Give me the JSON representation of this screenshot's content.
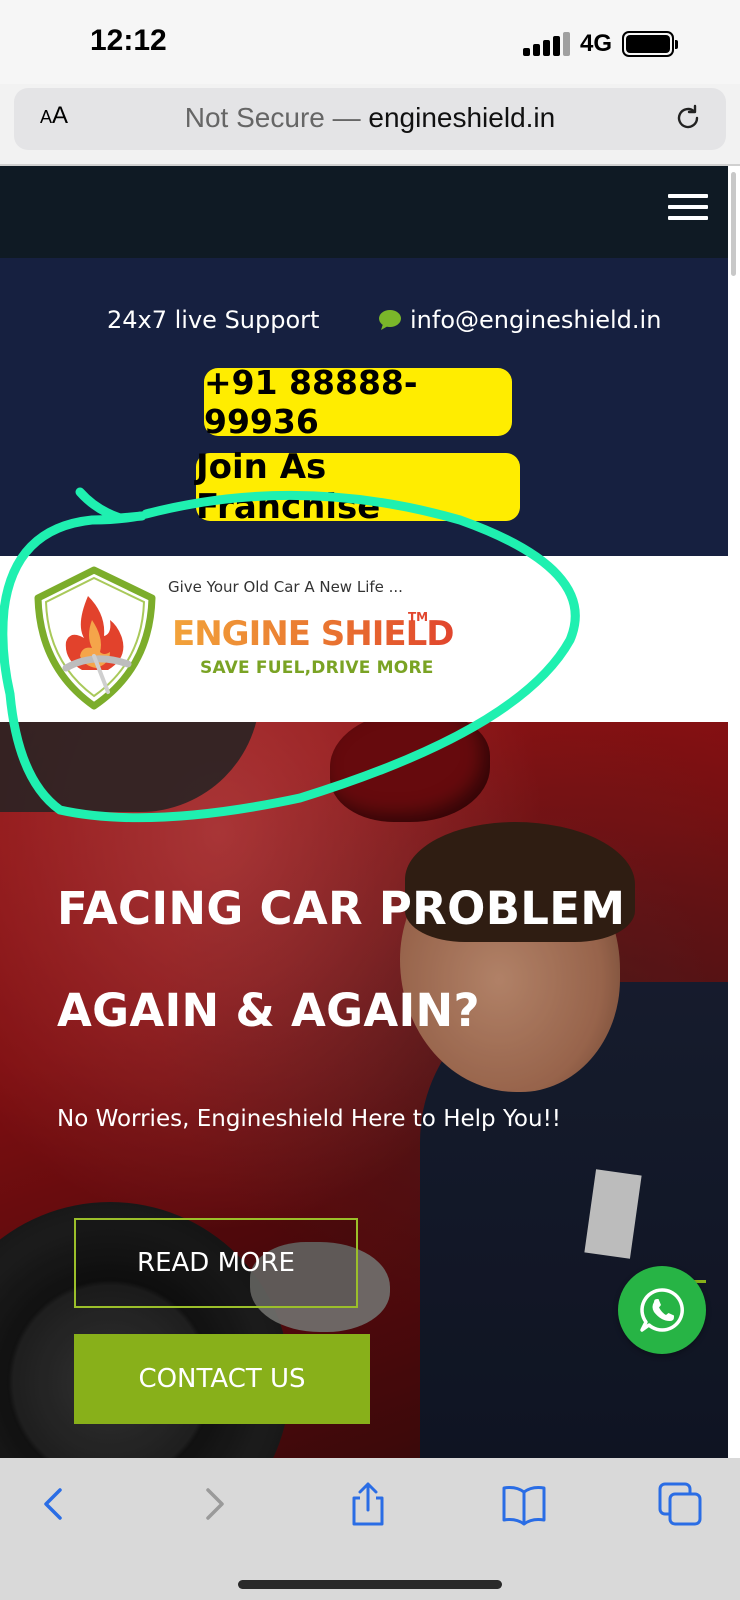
{
  "status_bar": {
    "time": "12:12",
    "network": "4G"
  },
  "browser": {
    "url_prefix": "Not Secure — ",
    "url_domain": "engineshield.in",
    "aa_small": "A",
    "aa_large": "A"
  },
  "top_info": {
    "support": "24x7 live Support",
    "email": "info@engineshield.in",
    "phone": "+91 88888-99936",
    "franchise": "Join As Franchise"
  },
  "logo": {
    "tagline": "Give Your Old Car A New Life ...",
    "brand": "ENGINE SHIELD",
    "trademark": "TM",
    "slogan": "SAVE FUEL,DRIVE MORE"
  },
  "hero": {
    "title_line1": "FACING CAR PROBLEM",
    "title_line2": "AGAIN & AGAIN?",
    "subtitle": "No Worries, Engineshield Here to Help You!!",
    "read_more": "READ MORE",
    "contact": "CONTACT US"
  },
  "colors": {
    "nav_bg": "#0f1a24",
    "info_bg": "#162040",
    "button_yellow": "#ffed00",
    "accent_green": "#88b01a",
    "whatsapp_green": "#27b445",
    "annotation": "#1ff0b0",
    "ios_blue": "#2a6de5"
  },
  "icons": [
    "reload-icon",
    "hamburger-menu-icon",
    "chat-bubble-icon",
    "shield-logo-icon",
    "whatsapp-icon",
    "back-icon",
    "forward-icon",
    "share-icon",
    "bookmarks-icon",
    "tabs-icon"
  ]
}
